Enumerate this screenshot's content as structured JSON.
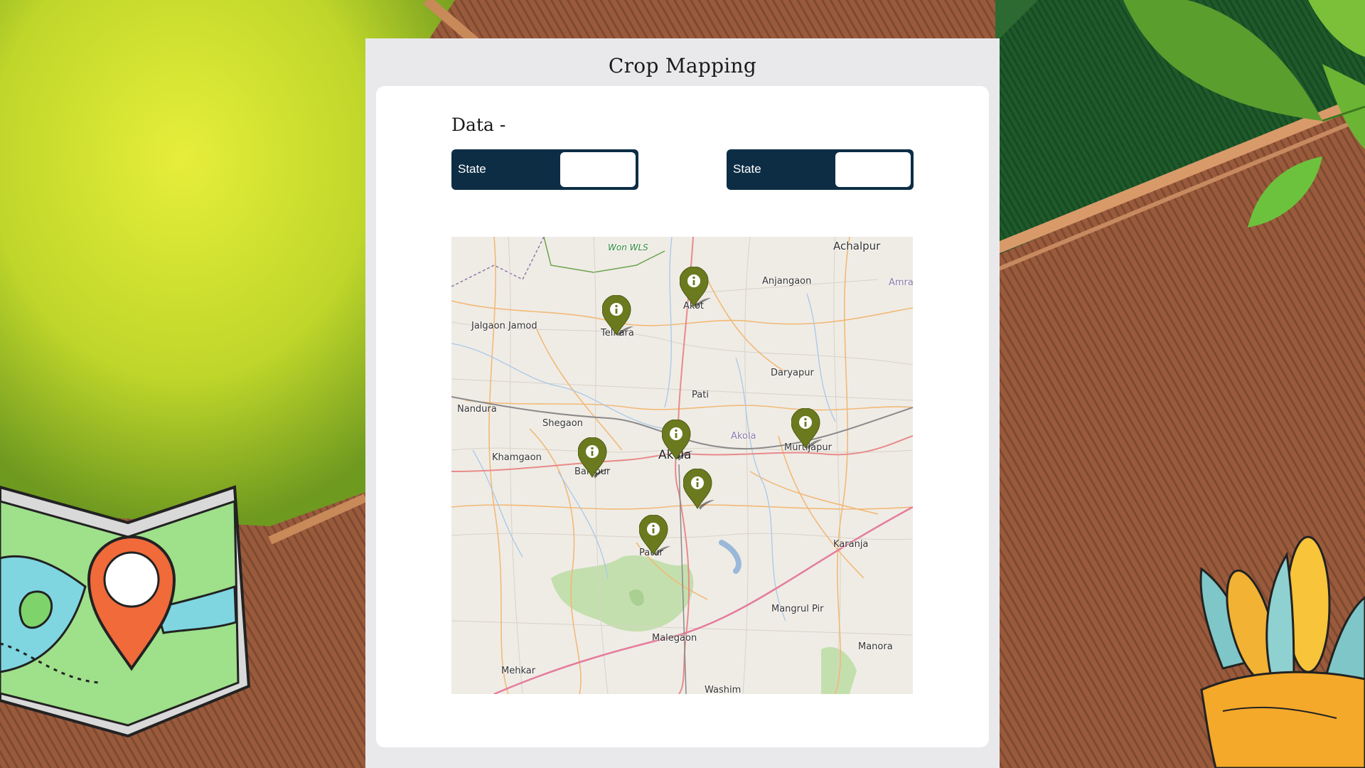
{
  "app": {
    "title": "Crop Mapping",
    "data_label": "Data -"
  },
  "filters": [
    {
      "label": "State",
      "value": ""
    },
    {
      "label": "State",
      "value": ""
    }
  ],
  "map": {
    "towns": [
      {
        "name": "Won WLS",
        "style": "green"
      },
      {
        "name": "Achalpur",
        "style": "normal"
      },
      {
        "name": "Anjangaon",
        "style": "normal"
      },
      {
        "name": "Amra",
        "style": "faint"
      },
      {
        "name": "Akot",
        "style": "normal"
      },
      {
        "name": "Jalgaon Jamod",
        "style": "normal"
      },
      {
        "name": "Telhara",
        "style": "normal"
      },
      {
        "name": "Daryapur",
        "style": "normal"
      },
      {
        "name": "Pati",
        "style": "normal"
      },
      {
        "name": "Nandura",
        "style": "normal"
      },
      {
        "name": "Shegaon",
        "style": "normal"
      },
      {
        "name": "Akola",
        "style": "faint"
      },
      {
        "name": "Murtijapur",
        "style": "normal"
      },
      {
        "name": "Khamgaon",
        "style": "normal"
      },
      {
        "name": "Akola",
        "style": "big"
      },
      {
        "name": "Balapur",
        "style": "normal"
      },
      {
        "name": "Karanja",
        "style": "normal"
      },
      {
        "name": "Patur",
        "style": "normal"
      },
      {
        "name": "Mangrul Pir",
        "style": "normal"
      },
      {
        "name": "Malegaon",
        "style": "normal"
      },
      {
        "name": "Manora",
        "style": "normal"
      },
      {
        "name": "Mehkar",
        "style": "normal"
      },
      {
        "name": "Washim",
        "style": "normal"
      }
    ],
    "markers": [
      "Akot",
      "Telhara",
      "Akola",
      "Balapur",
      "Murtijapur",
      "South Akola",
      "Patur"
    ],
    "marker_color": "#6b7a1f"
  },
  "colors": {
    "panel": "#e9e9ec",
    "select": "#0d2d45"
  }
}
